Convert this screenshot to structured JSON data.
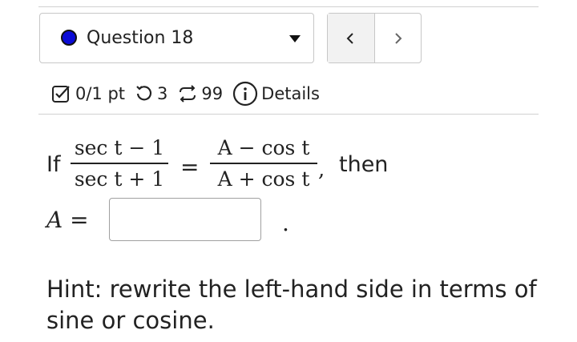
{
  "question_select": {
    "label": "Question 18",
    "status_color": "#0b0bd6",
    "caret_icon": "caret-down-icon"
  },
  "nav": {
    "prev_icon": "chevron-left-icon",
    "next_icon": "chevron-right-icon"
  },
  "meta": {
    "score": "0/1 pt",
    "attempts": "3",
    "versions": "99",
    "details": "Details"
  },
  "problem": {
    "if_word": "If",
    "lhs_num": "sec t − 1",
    "lhs_den": "sec t + 1",
    "rhs_num": "A − cos t",
    "rhs_den": "A + cos t",
    "equals": "=",
    "comma": ",",
    "then_word": "then",
    "answer_label": "A =",
    "answer_value": "",
    "period": "."
  },
  "hint": "Hint: rewrite the left-hand side in terms of sine or cosine."
}
